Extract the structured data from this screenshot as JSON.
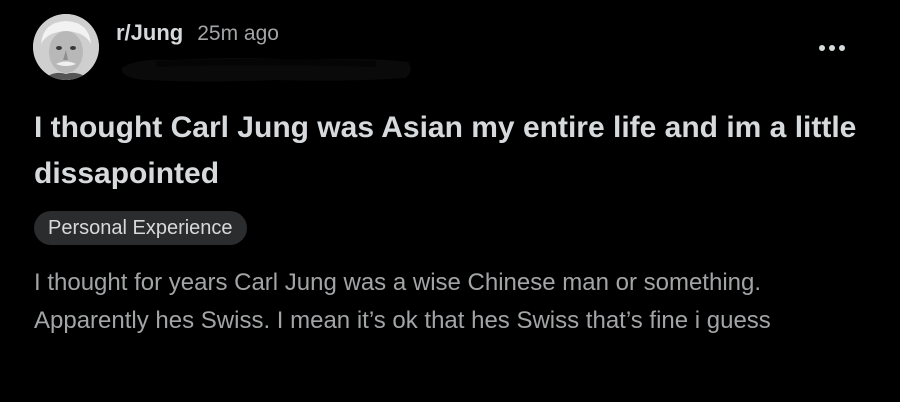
{
  "post": {
    "subreddit": "r/Jung",
    "time_ago": "25m ago",
    "avatar_icon": "user-avatar-icon",
    "more_icon": "more-options-icon",
    "title": "I thought Carl Jung was Asian my entire life and im a little dissapointed",
    "flair": "Personal Experience",
    "body": "I thought for years Carl Jung was a wise Chinese man or something. Apparently hes Swiss. I mean it’s ok that hes Swiss that’s fine i guess"
  },
  "colors": {
    "background": "#000000",
    "title_text": "#d7dadc",
    "meta_text": "#a2a4a6",
    "flair_bg": "#2a2c2e"
  }
}
